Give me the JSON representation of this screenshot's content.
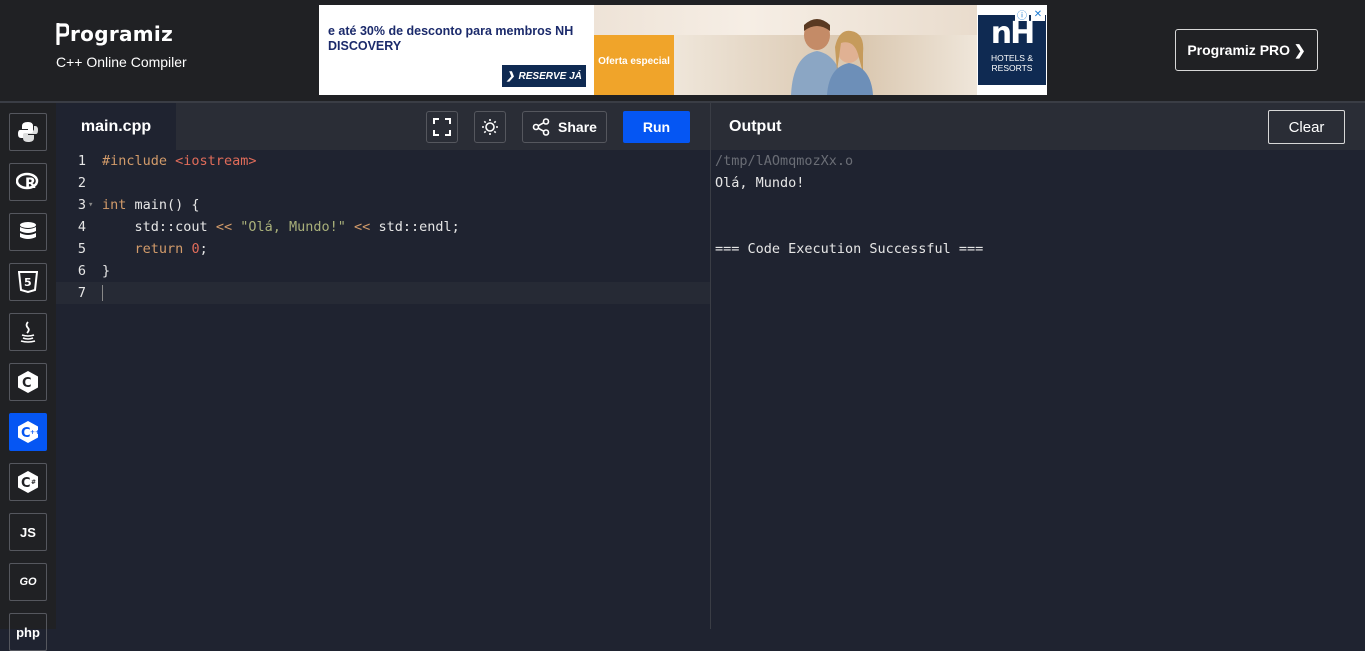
{
  "header": {
    "brand": "rogramiz",
    "subtitle": "C++ Online Compiler",
    "pro_button": "Programiz PRO ❯"
  },
  "ad": {
    "text": "e até 30% de desconto para membros NH DISCOVERY",
    "reserve": "RESERVE JÁ",
    "offer": "Oferta especial",
    "nh_logo": "nH",
    "nh_sub": "HOTELS & RESORTS",
    "info_icon": "ⓘ",
    "close_icon": "✕"
  },
  "sidebar": {
    "languages": [
      {
        "name": "python",
        "icon": "python-icon"
      },
      {
        "name": "r",
        "icon": "r-icon"
      },
      {
        "name": "sql",
        "icon": "database-icon"
      },
      {
        "name": "html",
        "icon": "html5-icon"
      },
      {
        "name": "java",
        "icon": "java-icon"
      },
      {
        "name": "c",
        "icon": "c-icon"
      },
      {
        "name": "cpp",
        "icon": "cpp-icon",
        "active": true
      },
      {
        "name": "csharp",
        "icon": "csharp-icon"
      },
      {
        "name": "js",
        "label": "JS"
      },
      {
        "name": "go",
        "label": "GO"
      },
      {
        "name": "php",
        "label": "php"
      }
    ]
  },
  "editor": {
    "tab_label": "main.cpp",
    "share_label": "Share",
    "run_label": "Run",
    "lines": [
      {
        "n": "1",
        "text": "#include <iostream>"
      },
      {
        "n": "2",
        "text": ""
      },
      {
        "n": "3",
        "text": "int main() {"
      },
      {
        "n": "4",
        "text": "    std::cout << \"Olá, Mundo!\" << std::endl;"
      },
      {
        "n": "5",
        "text": "    return 0;"
      },
      {
        "n": "6",
        "text": "}"
      },
      {
        "n": "7",
        "text": ""
      }
    ],
    "tokens": {
      "include": "#include",
      "header": "<iostream>",
      "int_kw": "int",
      "main_sig": " main() {",
      "cout": "std::cout",
      "shl": "<<",
      "string": "\"Olá, Mundo!\"",
      "endl": "std::endl;",
      "return_kw": "return",
      "zero": "0",
      "semicolon": ";",
      "close_brace": "}"
    }
  },
  "output": {
    "title": "Output",
    "clear_label": "Clear",
    "lines": [
      "/tmp/lAOmqmozXx.o",
      "Olá, Mundo!",
      "",
      "",
      "=== Code Execution Successful ==="
    ]
  },
  "colors": {
    "accent": "#0556f3",
    "background": "#1f2330",
    "header_bg": "#202124"
  }
}
